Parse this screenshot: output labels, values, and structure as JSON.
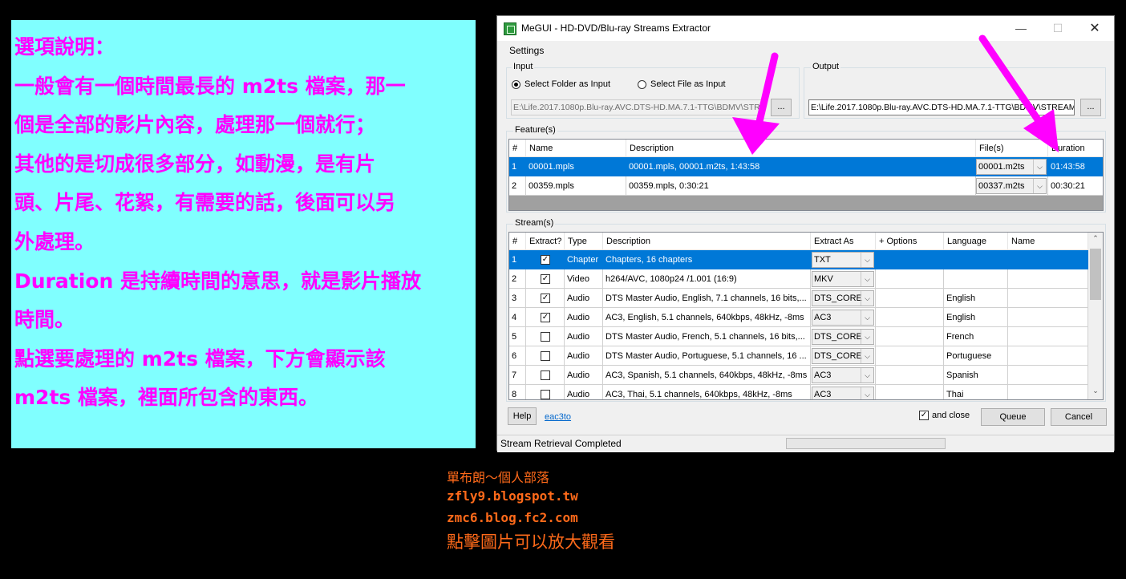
{
  "note": {
    "lines": [
      "選項說明：",
      "一般會有一個時間最長的 m2ts 檔案，那一",
      "個是全部的影片內容，處理那一個就行；",
      "其他的是切成很多部分，如動漫，是有片",
      "頭、片尾、花絮，有需要的話，後面可以另",
      "外處理。",
      "Duration 是持續時間的意思，就是影片播放",
      "時間。",
      "點選要處理的 m2ts 檔案，下方會顯示該",
      "m2ts 檔案，裡面所包含的東西。"
    ]
  },
  "window": {
    "title": "MeGUI - HD-DVD/Blu-ray Streams Extractor",
    "min_glyph": "—",
    "max_glyph": "☐",
    "close_glyph": "✕"
  },
  "menu": {
    "settings": "Settings"
  },
  "input": {
    "label": "Input",
    "radio_folder": "Select Folder as Input",
    "radio_file": "Select File as Input",
    "path": "E:\\Life.2017.1080p.Blu-ray.AVC.DTS-HD.MA.7.1-TTG\\BDMV\\STR",
    "browse": "..."
  },
  "output": {
    "label": "Output",
    "path": "E:\\Life.2017.1080p.Blu-ray.AVC.DTS-HD.MA.7.1-TTG\\BDMV\\STREAM",
    "browse": "..."
  },
  "features": {
    "label": "Feature(s)",
    "headers": [
      "#",
      "Name",
      "Description",
      "File(s)",
      "Duration"
    ],
    "rows": [
      {
        "num": "1",
        "name": "00001.mpls",
        "desc": "00001.mpls, 00001.m2ts, 1:43:58",
        "file": "00001.m2ts",
        "duration": "01:43:58"
      },
      {
        "num": "2",
        "name": "00359.mpls",
        "desc": "00359.mpls, 0:30:21",
        "file": "00337.m2ts",
        "duration": "00:30:21"
      }
    ]
  },
  "streams": {
    "label": "Stream(s)",
    "headers": [
      "#",
      "Extract?",
      "Type",
      "Description",
      "Extract As",
      "+ Options",
      "Language",
      "Name"
    ],
    "rows": [
      {
        "num": "1",
        "checked": true,
        "type": "Chapter",
        "desc": "Chapters, 16 chapters",
        "extract_as": "TXT",
        "options": "",
        "language": "",
        "name": ""
      },
      {
        "num": "2",
        "checked": true,
        "type": "Video",
        "desc": "h264/AVC, 1080p24 /1.001 (16:9)",
        "extract_as": "MKV",
        "options": "",
        "language": "",
        "name": ""
      },
      {
        "num": "3",
        "checked": true,
        "type": "Audio",
        "desc": "DTS Master Audio, English, 7.1 channels, 16 bits,...",
        "extract_as": "DTS_CORE",
        "options": "",
        "language": "English",
        "name": ""
      },
      {
        "num": "4",
        "checked": true,
        "type": "Audio",
        "desc": "AC3, English, 5.1 channels, 640kbps, 48kHz, -8ms",
        "extract_as": "AC3",
        "options": "",
        "language": "English",
        "name": ""
      },
      {
        "num": "5",
        "checked": false,
        "type": "Audio",
        "desc": "DTS Master Audio, French, 5.1 channels, 16 bits,...",
        "extract_as": "DTS_CORE",
        "options": "",
        "language": "French",
        "name": ""
      },
      {
        "num": "6",
        "checked": false,
        "type": "Audio",
        "desc": "DTS Master Audio, Portuguese, 5.1 channels, 16 ...",
        "extract_as": "DTS_CORE",
        "options": "",
        "language": "Portuguese",
        "name": ""
      },
      {
        "num": "7",
        "checked": false,
        "type": "Audio",
        "desc": "AC3, Spanish, 5.1 channels, 640kbps, 48kHz, -8ms",
        "extract_as": "AC3",
        "options": "",
        "language": "Spanish",
        "name": ""
      },
      {
        "num": "8",
        "checked": false,
        "type": "Audio",
        "desc": "AC3, Thai, 5.1 channels, 640kbps, 48kHz, -8ms",
        "extract_as": "AC3",
        "options": "",
        "language": "Thai",
        "name": ""
      }
    ]
  },
  "bottom": {
    "help": "Help",
    "link": "eac3to",
    "and_close": "and close",
    "queue": "Queue",
    "cancel": "Cancel"
  },
  "status": {
    "text": "Stream Retrieval Completed"
  },
  "credits": {
    "line1": "單布朗～個人部落",
    "line2": "zfly9.blogspot.tw",
    "line3": "zmc6.blog.fc2.com",
    "line4": "點擊圖片可以放大觀看"
  },
  "colors": {
    "note_bg": "#80ffff",
    "note_text": "#ff00ff",
    "selection": "#0078d7",
    "credit": "#ff6a1a",
    "arrow": "#ff00ff"
  }
}
